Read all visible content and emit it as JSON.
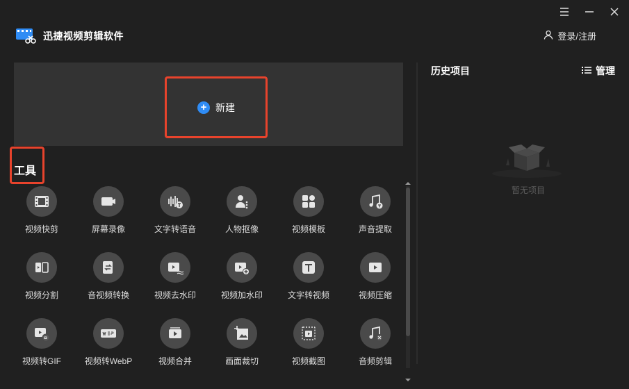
{
  "app": {
    "title": "迅捷视频剪辑软件",
    "accent_color": "#2f8cf5",
    "highlight_color": "#e8432c"
  },
  "window_controls": [
    "menu-icon",
    "minimize-icon",
    "close-icon"
  ],
  "header": {
    "login_label": "登录/注册",
    "login_icon": "user-icon"
  },
  "new_project": {
    "label": "新建",
    "icon": "plus-circle-icon"
  },
  "tools": {
    "title": "工具",
    "items": [
      {
        "label": "视频快剪",
        "icon": "film-icon"
      },
      {
        "label": "屏幕录像",
        "icon": "camera-icon"
      },
      {
        "label": "文字转语音",
        "icon": "text-to-speech-icon"
      },
      {
        "label": "人物抠像",
        "icon": "person-cutout-icon"
      },
      {
        "label": "视频模板",
        "icon": "template-icon"
      },
      {
        "label": "声音提取",
        "icon": "music-extract-icon"
      },
      {
        "label": "视频分割",
        "icon": "video-split-icon"
      },
      {
        "label": "音视频转换",
        "icon": "convert-icon"
      },
      {
        "label": "视频去水印",
        "icon": "remove-watermark-icon"
      },
      {
        "label": "视频加水印",
        "icon": "add-watermark-icon"
      },
      {
        "label": "文字转视频",
        "icon": "text-to-video-icon"
      },
      {
        "label": "视频压缩",
        "icon": "compress-icon"
      },
      {
        "label": "视频转GIF",
        "icon": "gif-icon"
      },
      {
        "label": "视频转WebP",
        "icon": "webp-icon"
      },
      {
        "label": "视频合并",
        "icon": "merge-icon"
      },
      {
        "label": "画面裁切",
        "icon": "crop-icon"
      },
      {
        "label": "视频截图",
        "icon": "screenshot-icon"
      },
      {
        "label": "音频剪辑",
        "icon": "audio-cut-icon"
      }
    ]
  },
  "history": {
    "title": "历史项目",
    "manage_label": "管理",
    "empty_text": "暂无项目",
    "empty_icon": "empty-box-icon"
  }
}
